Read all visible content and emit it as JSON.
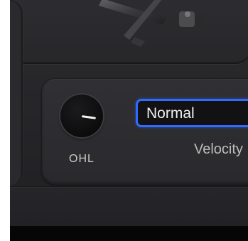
{
  "knob": {
    "label": "OHL",
    "icon": "knob-icon"
  },
  "velocity": {
    "selected": "Normal",
    "caption": "Velocity",
    "accent": "#2f6bff"
  },
  "image": {
    "name": "drum-kit-image"
  }
}
